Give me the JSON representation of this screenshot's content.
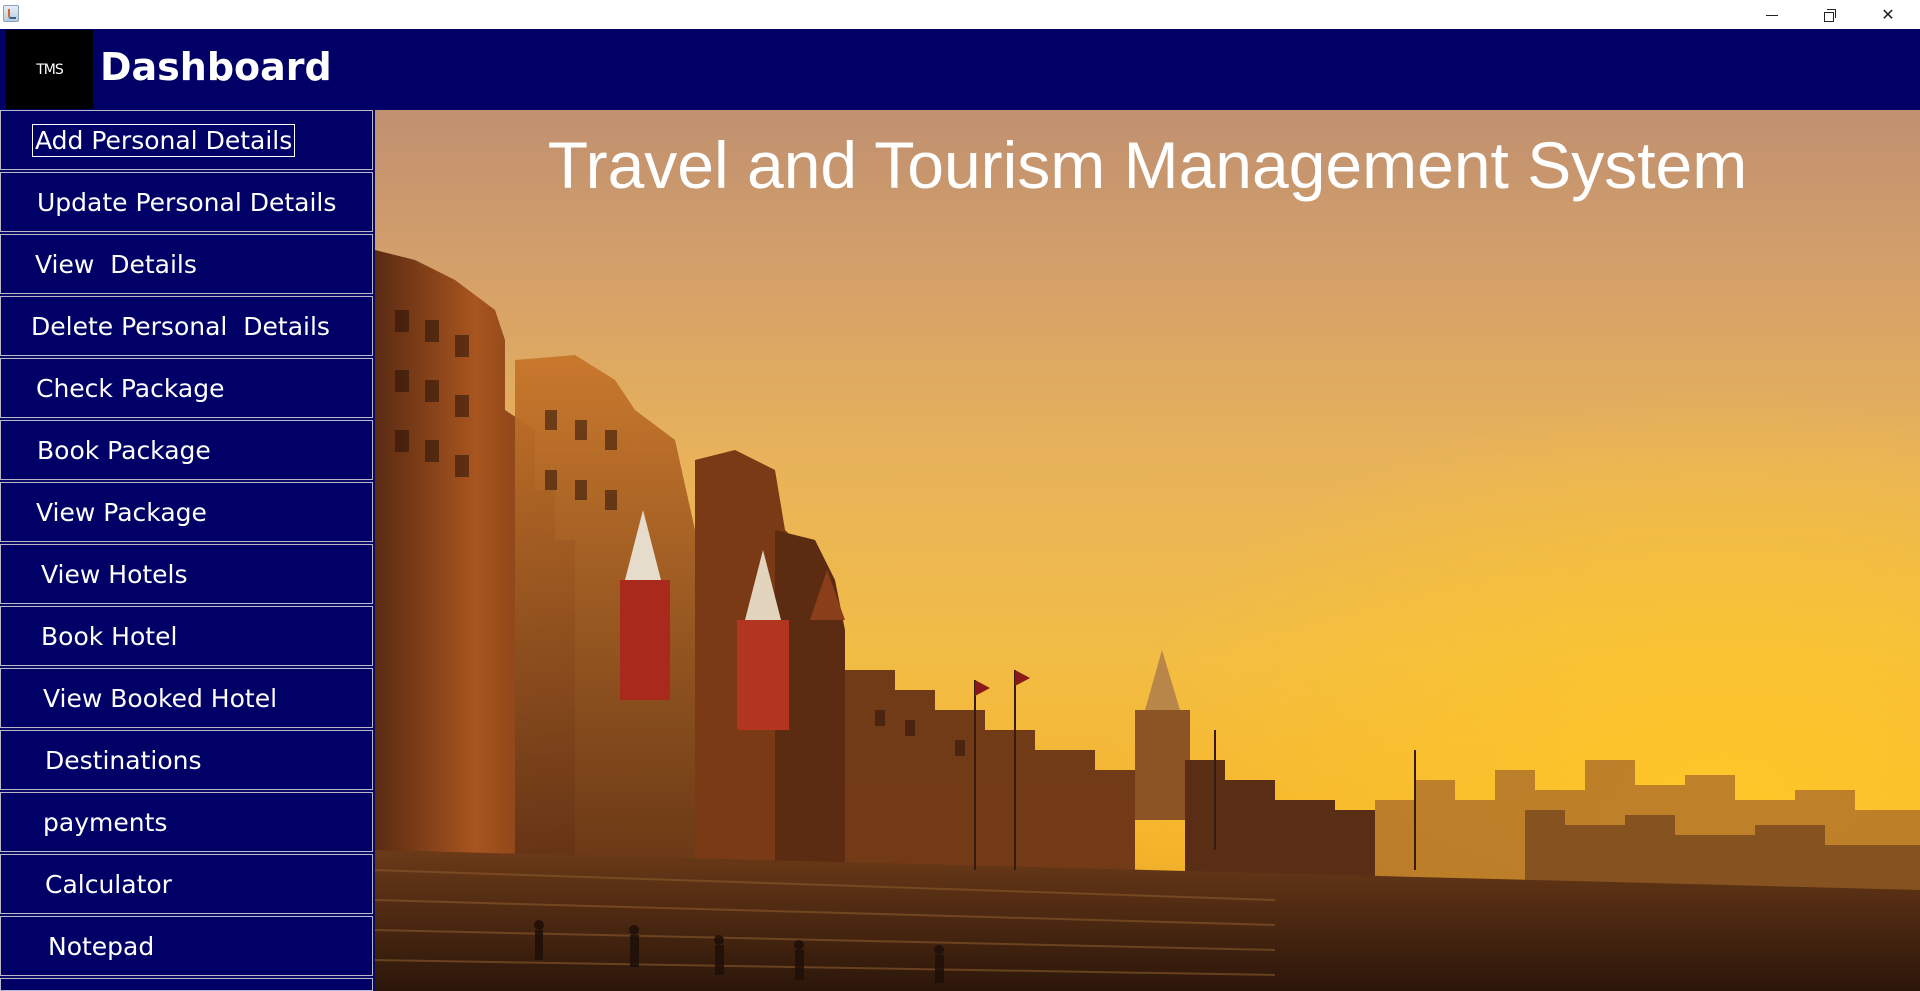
{
  "window": {
    "minimize_icon": "minimize-icon",
    "maximize_icon": "restore-icon",
    "close_glyph": "✕"
  },
  "header": {
    "logo_text": "TMS",
    "title": "Dashboard"
  },
  "sidebar": {
    "items": [
      {
        "label": "Add Personal Details",
        "focused": true
      },
      {
        "label": "Update Personal Details"
      },
      {
        "label": "View  Details"
      },
      {
        "label": "Delete Personal  Details"
      },
      {
        "label": "Check Package"
      },
      {
        "label": "Book Package"
      },
      {
        "label": "View Package"
      },
      {
        "label": "View Hotels"
      },
      {
        "label": "Book Hotel"
      },
      {
        "label": "View Booked Hotel"
      },
      {
        "label": "Destinations"
      },
      {
        "label": "payments"
      },
      {
        "label": "Calculator"
      },
      {
        "label": "Notepad"
      }
    ]
  },
  "main": {
    "title": "Travel and Tourism Management System",
    "background_image": "varanasi-ghats-sunset"
  },
  "colors": {
    "header_bg": "#000066",
    "sidebar_button_bg": "#000066",
    "logo_bg": "#000000",
    "text": "#ffffff"
  }
}
